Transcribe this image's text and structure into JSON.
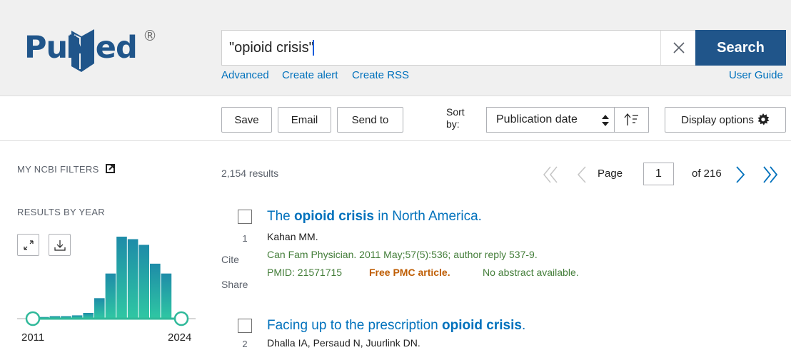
{
  "header": {
    "logo_pub": "Pub",
    "logo_med": "Med",
    "logo_reg": "®",
    "search": {
      "value": "\"opioid crisis\"",
      "button_label": "Search"
    },
    "links": {
      "advanced": "Advanced",
      "create_alert": "Create alert",
      "create_rss": "Create RSS",
      "user_guide": "User Guide"
    }
  },
  "toolbar": {
    "save": "Save",
    "email": "Email",
    "send_to": "Send to",
    "sort_by_label": "Sort by:",
    "sort_value": "Publication date",
    "display_options": "Display options"
  },
  "sidebar": {
    "my_ncbi_filters": "MY NCBI FILTERS",
    "results_by_year": "RESULTS BY YEAR",
    "year_start": "2011",
    "year_end": "2024",
    "histogram_values": [
      2,
      3,
      3,
      4,
      7,
      25,
      55,
      100,
      97,
      90,
      67,
      55
    ]
  },
  "results": {
    "count": "2,154 results",
    "page_label": "Page",
    "page_value": "1",
    "page_total": "of 216",
    "cite": "Cite",
    "share": "Share",
    "items": [
      {
        "num": "1",
        "title_pre": "The ",
        "title_bold": "opioid crisis",
        "title_post": " in North America.",
        "authors": "Kahan MM.",
        "citation": "Can Fam Physician. 2011 May;57(5):536; author reply 537-9.",
        "pmid": "PMID: 21571715",
        "free": "Free PMC article.",
        "note": "No abstract available."
      },
      {
        "num": "2",
        "title_pre": "Facing up to the prescription ",
        "title_bold": "opioid crisis",
        "title_post": ".",
        "authors": "Dhalla IA, Persaud N, Juurlink DN."
      }
    ]
  },
  "colors": {
    "brand": "#20558a",
    "link": "#0071bc",
    "citation": "#447e3a",
    "free": "#bf5e05",
    "bar_top": "#1e8ca8",
    "bar_bottom": "#2fc7a3"
  }
}
